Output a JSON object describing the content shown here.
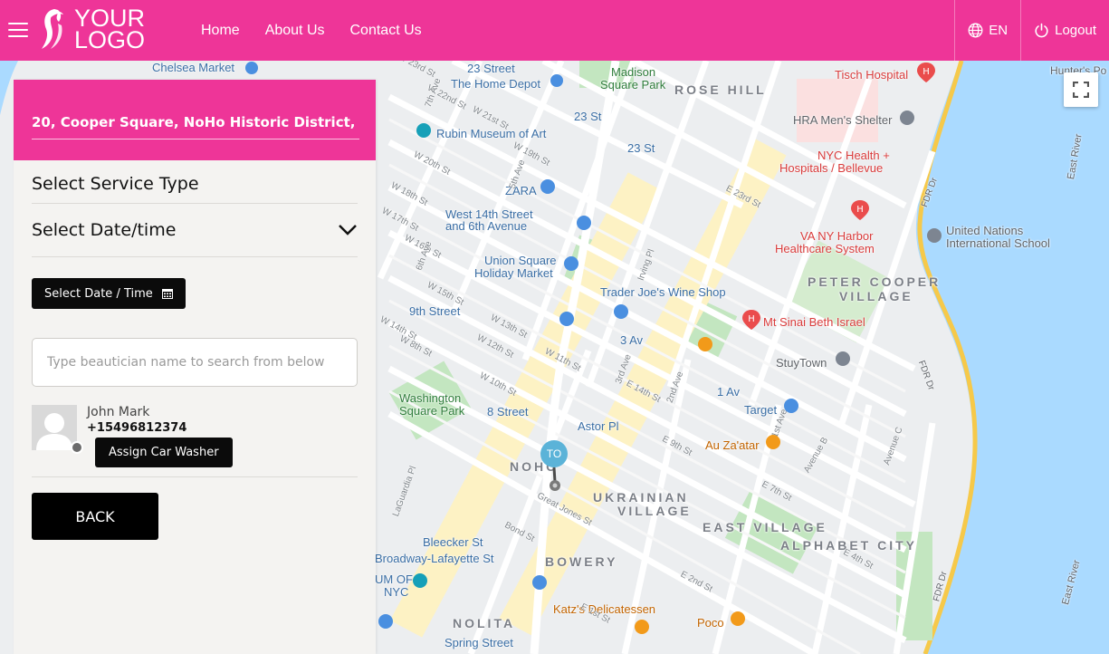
{
  "header": {
    "logo_line1": "YOUR",
    "logo_line2": "LOGO",
    "nav": [
      "Home",
      "About Us",
      "Contact Us"
    ],
    "language": "EN",
    "logout": "Logout",
    "brand_color": "#ee3598"
  },
  "panel": {
    "address": "20, Cooper Square, NoHo Historic District, NoHo",
    "service_type_heading": "Select Service Type",
    "datetime_heading": "Select Date/time",
    "datetime_button": "Select Date / Time",
    "search_placeholder": "Type beautician name to search from below",
    "person": {
      "name": "John Mark",
      "phone": "+15496812374",
      "assign_button": "Assign Car Washer"
    },
    "back_button": "BACK"
  },
  "map": {
    "marker_label": "TO",
    "places": [
      {
        "label": "Chelsea Market",
        "style": "blue"
      },
      {
        "label": "23 Street",
        "style": "blue"
      },
      {
        "label": "The Home Depot",
        "style": "blue"
      },
      {
        "label": "Madison",
        "style": "green"
      },
      {
        "label": "Square Park",
        "style": "green"
      },
      {
        "label": "ROSE HILL",
        "style": "district"
      },
      {
        "label": "Tisch Hospital",
        "style": "red"
      },
      {
        "label": "23 St",
        "style": "blue"
      },
      {
        "label": "Rubin Museum of Art",
        "style": "blue"
      },
      {
        "label": "HRA Men's Shelter",
        "style": "gray"
      },
      {
        "label": "23 St",
        "style": "blue"
      },
      {
        "label": "NYC Health +",
        "style": "red"
      },
      {
        "label": "Hospitals / Bellevue",
        "style": "red"
      },
      {
        "label": "ZARA",
        "style": "blue"
      },
      {
        "label": "West 14th Street",
        "style": "blue"
      },
      {
        "label": "and 6th Avenue",
        "style": "blue"
      },
      {
        "label": "VA NY Harbor",
        "style": "red"
      },
      {
        "label": "Healthcare System",
        "style": "red"
      },
      {
        "label": "United Nations",
        "style": "gray"
      },
      {
        "label": "International School",
        "style": "gray"
      },
      {
        "label": "Union Square",
        "style": "blue"
      },
      {
        "label": "Holiday Market",
        "style": "blue"
      },
      {
        "label": "PETER COOPER",
        "style": "district"
      },
      {
        "label": "VILLAGE",
        "style": "district"
      },
      {
        "label": "Trader Joe's Wine Shop",
        "style": "blue"
      },
      {
        "label": "9th Street",
        "style": "blue"
      },
      {
        "label": "Mt Sinai Beth Israel",
        "style": "red"
      },
      {
        "label": "3 Av",
        "style": "blue"
      },
      {
        "label": "StuyTown",
        "style": "gray"
      },
      {
        "label": "1 Av",
        "style": "blue"
      },
      {
        "label": "Washington",
        "style": "green"
      },
      {
        "label": "Square Park",
        "style": "green"
      },
      {
        "label": "8 Street",
        "style": "blue"
      },
      {
        "label": "Astor Pl",
        "style": "blue"
      },
      {
        "label": "Target",
        "style": "blue"
      },
      {
        "label": "Au Za'atar",
        "style": "orange"
      },
      {
        "label": "NOHO",
        "style": "district"
      },
      {
        "label": "UKRAINIAN",
        "style": "district"
      },
      {
        "label": "VILLAGE",
        "style": "district"
      },
      {
        "label": "EAST VILLAGE",
        "style": "district"
      },
      {
        "label": "ALPHABET CITY",
        "style": "district"
      },
      {
        "label": "Bleecker St",
        "style": "blue"
      },
      {
        "label": "Broadway-Lafayette St",
        "style": "blue"
      },
      {
        "label": "BOWERY",
        "style": "district"
      },
      {
        "label": "UM OF",
        "style": "blue"
      },
      {
        "label": "NYC",
        "style": "blue"
      },
      {
        "label": "Katz's Delicatessen",
        "style": "orange"
      },
      {
        "label": "NOLITA",
        "style": "district"
      },
      {
        "label": "Poco",
        "style": "orange"
      },
      {
        "label": "Spring Street",
        "style": "blue"
      },
      {
        "label": "East River",
        "style": "gray"
      },
      {
        "label": "East River",
        "style": "gray"
      },
      {
        "label": "FDR Dr",
        "style": "gray"
      },
      {
        "label": "FDR Dr",
        "style": "gray"
      },
      {
        "label": "FDR Dr",
        "style": "gray"
      },
      {
        "label": "Hunter's Po",
        "style": "gray"
      }
    ],
    "streets": [
      "W 23rd St",
      "W 22nd St",
      "W 21st St",
      "W 20th St",
      "W 19th St",
      "W 18th St",
      "W 17th St",
      "W 16th St",
      "W 15th St",
      "W 14th St",
      "W 13th St",
      "W 12th St",
      "W 11th St",
      "W 10th St",
      "W 8th St",
      "7th Ave",
      "6th Ave",
      "5th Ave",
      "3rd Ave",
      "2nd Ave",
      "1st Ave",
      "E 23rd St",
      "E 14th St",
      "E 9th St",
      "E 7th St",
      "E 4th St",
      "E 2nd St",
      "E 1st St",
      "Irving Pl",
      "Avenue C",
      "Avenue B",
      "Bond St",
      "Great Jones St",
      "LaGuardia Pl"
    ]
  }
}
